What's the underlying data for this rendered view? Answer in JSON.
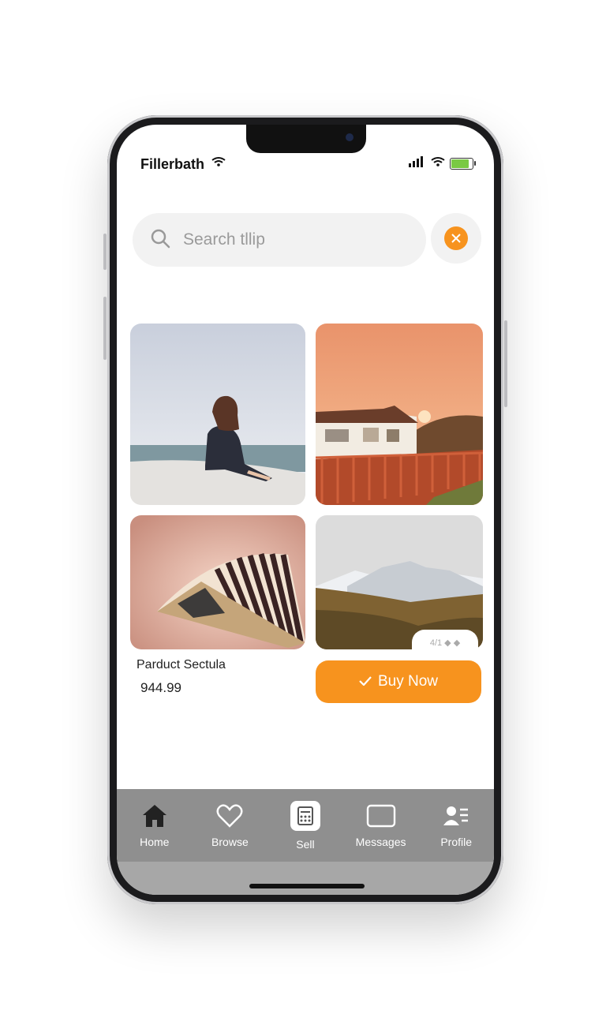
{
  "status": {
    "title": "Fillerbath"
  },
  "search": {
    "placeholder": "Search tllip"
  },
  "product": {
    "name": "Parduct Sectula",
    "price": "944.99"
  },
  "gallery": {
    "pager": "4/1 ◆ ◆"
  },
  "buy_button": {
    "label": "Buy Now",
    "color": "#f7931e"
  },
  "tabs": [
    {
      "label": "Home",
      "icon": "home-icon"
    },
    {
      "label": "Browse",
      "icon": "heart-icon"
    },
    {
      "label": "Sell",
      "icon": "calculator-icon"
    },
    {
      "label": "Messages",
      "icon": "message-icon"
    },
    {
      "label": "Profile",
      "icon": "profile-icon"
    }
  ],
  "colors": {
    "accent": "#f7931e",
    "tabbar": "#8f8f8f"
  }
}
